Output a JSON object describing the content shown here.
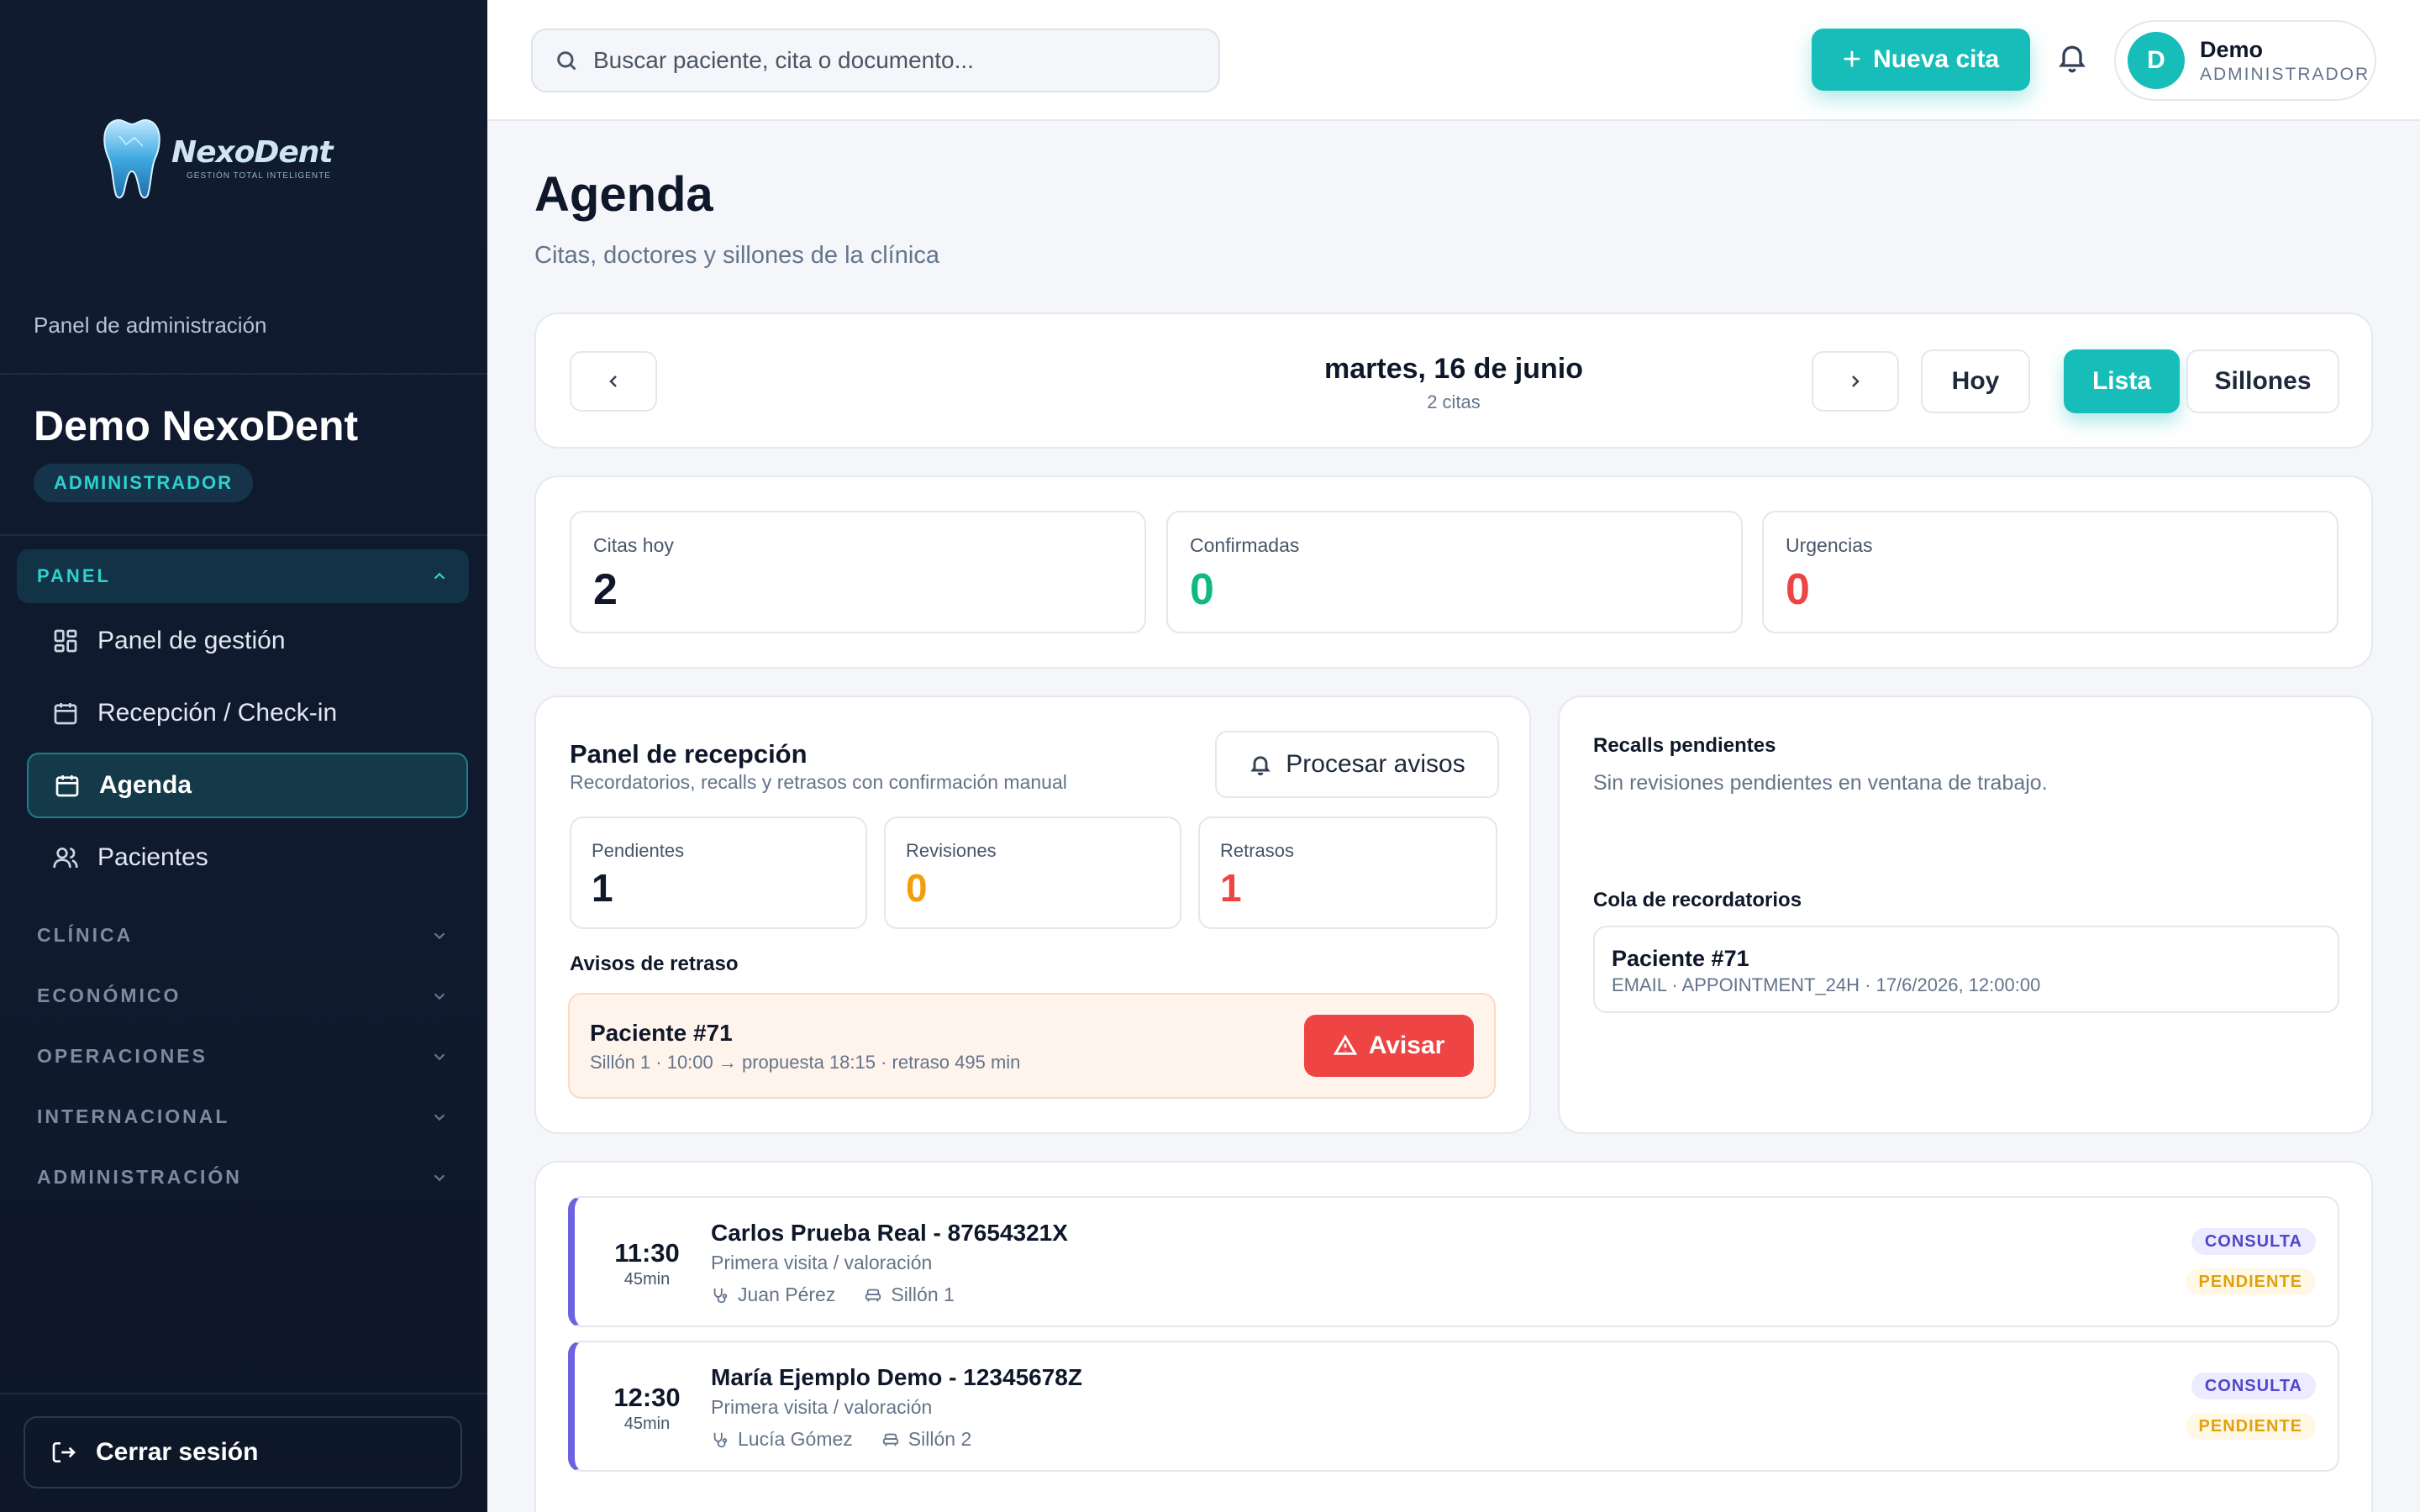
{
  "app": {
    "logo_name": "NexoDent",
    "logo_tagline": "GESTIÓN TOTAL INTELIGENTE"
  },
  "sidebar": {
    "panel_label": "Panel de administración",
    "org_name": "Demo NexoDent",
    "role": "ADMINISTRADOR",
    "section": "PANEL",
    "items": [
      {
        "label": "Panel de gestión",
        "icon": "grid-icon"
      },
      {
        "label": "Recepción / Check-in",
        "icon": "calendar-icon"
      },
      {
        "label": "Agenda",
        "icon": "calendar-icon",
        "active": true
      },
      {
        "label": "Pacientes",
        "icon": "users-icon"
      }
    ],
    "groups": [
      "CLÍNICA",
      "ECONÓMICO",
      "OPERACIONES",
      "INTERNACIONAL",
      "ADMINISTRACIÓN"
    ],
    "logout": "Cerrar sesión"
  },
  "topbar": {
    "search_placeholder": "Buscar paciente, cita o documento...",
    "new_button": "Nueva cita",
    "user_initial": "D",
    "user_name": "Demo",
    "user_role": "ADMINISTRADOR"
  },
  "page": {
    "title": "Agenda",
    "subtitle": "Citas, doctores y sillones de la clínica"
  },
  "datebar": {
    "date": "martes, 16 de junio",
    "count": "2 citas",
    "today": "Hoy",
    "view_list": "Lista",
    "view_chairs": "Sillones"
  },
  "stats": [
    {
      "label": "Citas hoy",
      "value": "2",
      "color": "#0f172a"
    },
    {
      "label": "Confirmadas",
      "value": "0",
      "color": "#10b981"
    },
    {
      "label": "Urgencias",
      "value": "0",
      "color": "#ef4444"
    }
  ],
  "reception": {
    "title": "Panel de recepción",
    "subtitle": "Recordatorios, recalls y retrasos con confirmación manual",
    "process_button": "Procesar avisos",
    "counters": [
      {
        "label": "Pendientes",
        "value": "1",
        "color": "#0f172a"
      },
      {
        "label": "Revisiones",
        "value": "0",
        "color": "#f59e0b"
      },
      {
        "label": "Retrasos",
        "value": "1",
        "color": "#ef4444"
      }
    ],
    "delays_title": "Avisos de retraso",
    "delay": {
      "patient": "Paciente #71",
      "detail": "Sillón 1 · 10:00 → propuesta 18:15 · retraso 495 min",
      "button": "Avisar"
    }
  },
  "recalls": {
    "title": "Recalls pendientes",
    "empty": "Sin revisiones pendientes en ventana de trabajo.",
    "queue_title": "Cola de recordatorios",
    "queue": [
      {
        "patient": "Paciente #71",
        "detail": "EMAIL · APPOINTMENT_24H · 17/6/2026, 12:00:00"
      }
    ]
  },
  "appointments": [
    {
      "time": "11:30",
      "duration": "45min",
      "name": "Carlos Prueba Real - 87654321X",
      "desc": "Primera visita / valoración",
      "doctor": "Juan Pérez",
      "chair": "Sillón 1",
      "type": "CONSULTA",
      "status": "PENDIENTE"
    },
    {
      "time": "12:30",
      "duration": "45min",
      "name": "María Ejemplo Demo - 12345678Z",
      "desc": "Primera visita / valoración",
      "doctor": "Lucía Gómez",
      "chair": "Sillón 2",
      "type": "CONSULTA",
      "status": "PENDIENTE"
    }
  ],
  "colors": {
    "accent": "#17bdb8",
    "sidebar_bg": "#101b30",
    "danger": "#ef4444",
    "appointment_bar": "#6b63e0"
  }
}
